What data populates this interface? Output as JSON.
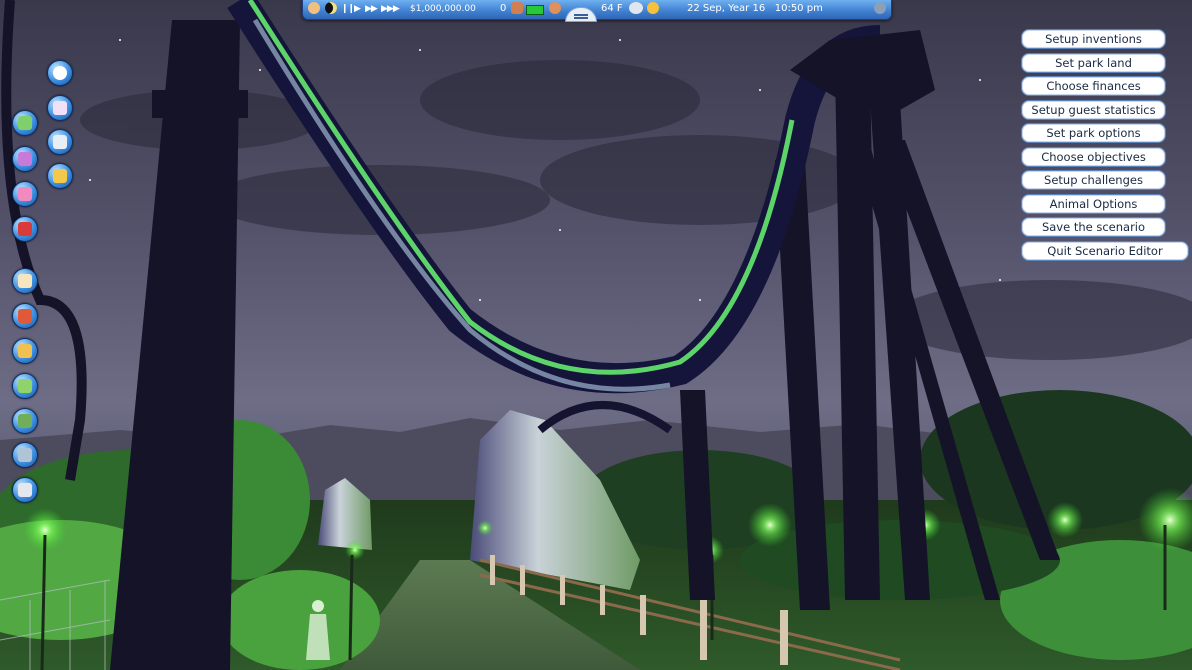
{
  "topbar": {
    "money": "$1,000,000.00",
    "guests": "0",
    "temperature": "64 F",
    "datetime": "22 Sep, Year 16   10:50 pm",
    "speed_controls": [
      "pause",
      "play",
      "fast",
      "fastest"
    ]
  },
  "left_toolbar": {
    "column_a": [
      "info-icon",
      "rides-icon",
      "save-icon",
      "open-folder-icon"
    ],
    "column_b": [
      "map-icon",
      "guests-icon",
      "staff-icon",
      "research-icon",
      "finance-icon",
      "messages-icon",
      "shops-icon",
      "terrain-icon",
      "scenery-icon",
      "paths-icon",
      "trash-icon"
    ]
  },
  "menu": {
    "items": [
      "Setup inventions",
      "Set park land",
      "Choose finances",
      "Setup guest statistics",
      "Set park options",
      "Choose objectives",
      "Setup challenges",
      "Animal Options",
      "Save the scenario",
      "Quit Scenario Editor"
    ]
  },
  "colors": {
    "sky": "#4a4860",
    "track_green": "#5dd46a",
    "supports": "#14132a",
    "ui_blue": "#3f7fd0"
  }
}
